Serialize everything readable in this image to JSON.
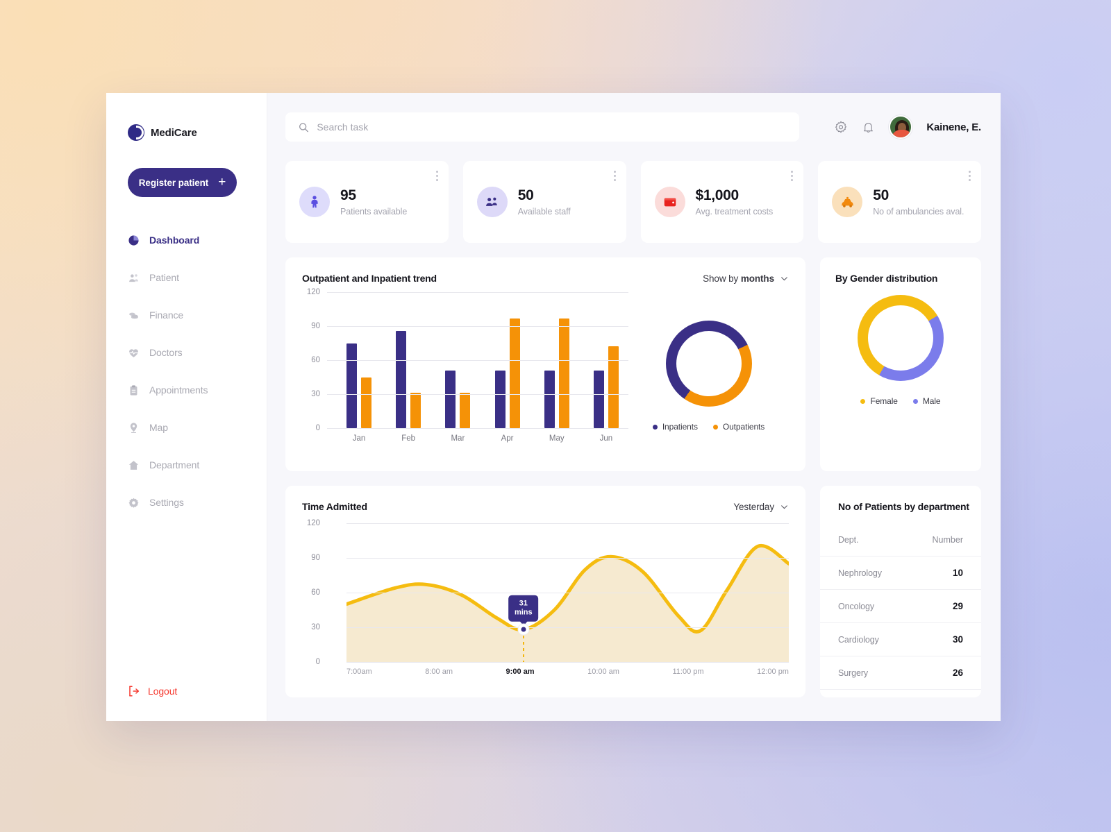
{
  "brand": {
    "name": "MediCare"
  },
  "sidebar": {
    "register_label": "Register patient",
    "items": [
      {
        "label": "Dashboard",
        "icon": "pie-chart-icon",
        "active": true
      },
      {
        "label": "Patient",
        "icon": "people-icon",
        "active": false
      },
      {
        "label": "Finance",
        "icon": "coins-icon",
        "active": false
      },
      {
        "label": "Doctors",
        "icon": "heart-pulse-icon",
        "active": false
      },
      {
        "label": "Appointments",
        "icon": "clipboard-icon",
        "active": false
      },
      {
        "label": "Map",
        "icon": "map-pin-icon",
        "active": false
      },
      {
        "label": "Department",
        "icon": "home-icon",
        "active": false
      },
      {
        "label": "Settings",
        "icon": "gear-icon",
        "active": false
      }
    ],
    "logout_label": "Logout"
  },
  "topbar": {
    "search_placeholder": "Search task",
    "search_value": "",
    "user_name": "Kainene, E."
  },
  "stats": [
    {
      "value": "95",
      "label": "Patients available",
      "icon": "patient-icon",
      "icon_bg": "#dedcfb",
      "icon_color": "#5b4fe0"
    },
    {
      "value": "50",
      "label": "Available staff",
      "icon": "staff-icon",
      "icon_bg": "#ddd9f8",
      "icon_color": "#3a2f86"
    },
    {
      "value": "$1,000",
      "label": "Avg. treatment costs",
      "icon": "wallet-icon",
      "icon_bg": "#fbdcda",
      "icon_color": "#e8231f"
    },
    {
      "value": "50",
      "label": "No of ambulancies aval.",
      "icon": "ambulance-icon",
      "icon_bg": "#fae0bb",
      "icon_color": "#f2890d"
    }
  ],
  "trend_panel": {
    "title": "Outpatient and Inpatient trend",
    "dropdown_prefix": "Show by",
    "dropdown_value": "months"
  },
  "gender_panel": {
    "title": "By Gender distribution"
  },
  "time_panel": {
    "title": "Time Admitted",
    "dropdown_value": "Yesterday",
    "tooltip": "31\nmins"
  },
  "dept_panel": {
    "title": "No of Patients by department",
    "columns": [
      "Dept.",
      "Number"
    ],
    "rows": [
      {
        "dept": "Nephrology",
        "number": "10"
      },
      {
        "dept": "Oncology",
        "number": "29"
      },
      {
        "dept": "Cardiology",
        "number": "30"
      },
      {
        "dept": "Surgery",
        "number": "26"
      }
    ]
  },
  "colors": {
    "primary": "#3a2f86",
    "orange": "#f59207",
    "yellow": "#f5bc10",
    "periwinkle": "#7b7ceb",
    "red": "#f5392f"
  },
  "chart_data": [
    {
      "type": "bar",
      "title": "Outpatient and Inpatient trend",
      "categories": [
        "Jan",
        "Feb",
        "Mar",
        "Apr",
        "May",
        "Jun"
      ],
      "series": [
        {
          "name": "Inpatients",
          "color": "#3a2f86",
          "values": [
            75,
            86,
            51,
            51,
            51,
            51
          ]
        },
        {
          "name": "Outpatients",
          "color": "#f59207",
          "values": [
            45,
            31,
            31,
            97,
            97,
            72
          ]
        }
      ],
      "yticks": [
        0,
        30,
        60,
        90,
        120
      ],
      "ylim": [
        0,
        120
      ],
      "xlabel": "",
      "ylabel": "",
      "grid": true,
      "legend": [
        "Inpatients",
        "Outpatients"
      ],
      "legend_position": "bottom"
    },
    {
      "type": "pie",
      "title": "Inpatients vs Outpatients",
      "labels": [
        "Inpatients",
        "Outpatients"
      ],
      "values": [
        58,
        42
      ],
      "colors": [
        "#3a2f86",
        "#f59207"
      ],
      "donut": true,
      "legend_position": "bottom"
    },
    {
      "type": "pie",
      "title": "By Gender distribution",
      "labels": [
        "Female",
        "Male"
      ],
      "values": [
        58,
        42
      ],
      "colors": [
        "#f5bc10",
        "#7b7ceb"
      ],
      "donut": true,
      "legend_position": "bottom"
    },
    {
      "type": "area",
      "title": "Time Admitted",
      "x": [
        "7:00am",
        "8:00 am",
        "9:00 am",
        "10:00 am",
        "11:00 pm",
        "12:00 pm"
      ],
      "xlabel": "",
      "ylabel": "",
      "yticks": [
        0,
        30,
        60,
        90,
        120
      ],
      "ylim": [
        0,
        120
      ],
      "series": [
        {
          "name": "Time admitted",
          "color": "#f5bc10",
          "values": [
            50,
            67,
            28,
            91,
            27,
            85
          ],
          "detail_points": [
            {
              "t": 7.0,
              "v": 50
            },
            {
              "t": 7.55,
              "v": 64
            },
            {
              "t": 7.9,
              "v": 67
            },
            {
              "t": 8.3,
              "v": 58
            },
            {
              "t": 8.7,
              "v": 38
            },
            {
              "t": 9.0,
              "v": 28
            },
            {
              "t": 9.35,
              "v": 45
            },
            {
              "t": 9.7,
              "v": 80
            },
            {
              "t": 10.0,
              "v": 91
            },
            {
              "t": 10.35,
              "v": 78
            },
            {
              "t": 10.75,
              "v": 40
            },
            {
              "t": 11.0,
              "v": 27
            },
            {
              "t": 11.3,
              "v": 62
            },
            {
              "t": 11.65,
              "v": 100
            },
            {
              "t": 12.0,
              "v": 85
            }
          ]
        }
      ],
      "marker": {
        "x_label": "9:00 am",
        "value": 28,
        "tooltip": "31 mins"
      },
      "grid": true
    }
  ]
}
